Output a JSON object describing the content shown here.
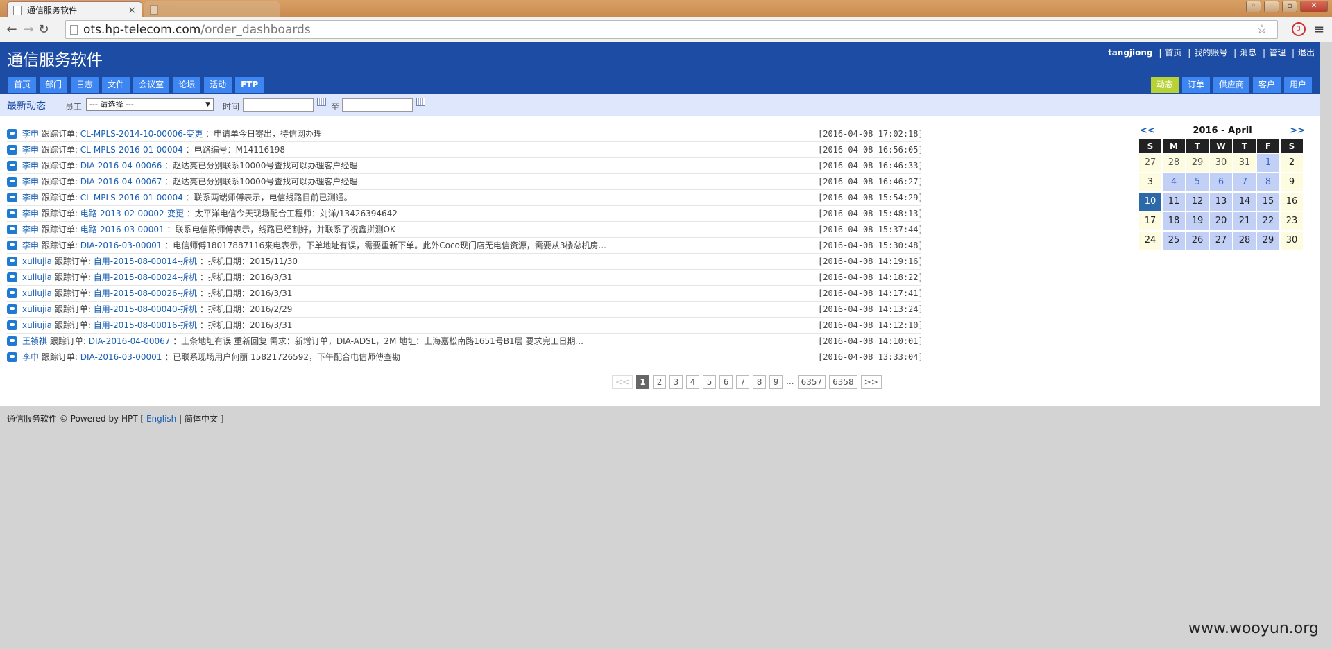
{
  "browser": {
    "active_tab": "通信服务软件",
    "url_host": "ots.hp-telecom.com",
    "url_path": "/order_dashboards",
    "ext_badge": "3"
  },
  "app": {
    "title": "通信服务软件",
    "username": "tangjiong",
    "user_links": [
      "首页",
      "我的账号",
      "消息",
      "管理",
      "退出"
    ],
    "main_nav": [
      "首页",
      "部门",
      "日志",
      "文件",
      "会议室",
      "论坛",
      "活动",
      "FTP"
    ],
    "sub_nav": [
      "动态",
      "订单",
      "供应商",
      "客户",
      "用户"
    ],
    "sub_nav_active": "动态"
  },
  "filter": {
    "title": "最新动态",
    "employee_label": "员工",
    "employee_value": "--- 请选择 ---",
    "time_label": "时间",
    "to_label": "至"
  },
  "feed": [
    {
      "user": "李申",
      "track": "跟踪订单:",
      "order": "CL-MPLS-2014-10-00006-变更",
      "text": "：申请单今日寄出，待信网办理",
      "ts": "[2016-04-08 17:02:18]"
    },
    {
      "user": "李申",
      "track": "跟踪订单:",
      "order": "CL-MPLS-2016-01-00004",
      "text": "：电路编号：M14116198",
      "ts": "[2016-04-08 16:56:05]"
    },
    {
      "user": "李申",
      "track": "跟踪订单:",
      "order": "DIA-2016-04-00066",
      "text": "：赵达亮已分别联系10000号查找可以办理客户经理",
      "ts": "[2016-04-08 16:46:33]"
    },
    {
      "user": "李申",
      "track": "跟踪订单:",
      "order": "DIA-2016-04-00067",
      "text": "：赵达亮已分别联系10000号查找可以办理客户经理",
      "ts": "[2016-04-08 16:46:27]"
    },
    {
      "user": "李申",
      "track": "跟踪订单:",
      "order": "CL-MPLS-2016-01-00004",
      "text": "：联系两端师傅表示，电信线路目前已测通。",
      "ts": "[2016-04-08 15:54:29]"
    },
    {
      "user": "李申",
      "track": "跟踪订单:",
      "order": "电路-2013-02-00002-变更",
      "text": "：太平洋电信今天现场配合工程师：刘洋/13426394642",
      "ts": "[2016-04-08 15:48:13]"
    },
    {
      "user": "李申",
      "track": "跟踪订单:",
      "order": "电路-2016-03-00001",
      "text": "：联系电信陈师傅表示，线路已经割好，并联系了祝鑫拼测OK",
      "ts": "[2016-04-08 15:37:44]"
    },
    {
      "user": "李申",
      "track": "跟踪订单:",
      "order": "DIA-2016-03-00001",
      "text": "：电信师傅18017887116来电表示，下单地址有误，需要重新下单。此外Coco现门店无电信资源，需要从3楼总机房...",
      "ts": "[2016-04-08 15:30:48]"
    },
    {
      "user": "xuliujia",
      "track": "跟踪订单:",
      "order": "自用-2015-08-00014-拆机",
      "text": "：拆机日期：2015/11/30",
      "ts": "[2016-04-08 14:19:16]"
    },
    {
      "user": "xuliujia",
      "track": "跟踪订单:",
      "order": "自用-2015-08-00024-拆机",
      "text": "：拆机日期：2016/3/31",
      "ts": "[2016-04-08 14:18:22]"
    },
    {
      "user": "xuliujia",
      "track": "跟踪订单:",
      "order": "自用-2015-08-00026-拆机",
      "text": "：拆机日期：2016/3/31",
      "ts": "[2016-04-08 14:17:41]"
    },
    {
      "user": "xuliujia",
      "track": "跟踪订单:",
      "order": "自用-2015-08-00040-拆机",
      "text": "：拆机日期：2016/2/29",
      "ts": "[2016-04-08 14:13:24]"
    },
    {
      "user": "xuliujia",
      "track": "跟踪订单:",
      "order": "自用-2015-08-00016-拆机",
      "text": "：拆机日期：2016/3/31",
      "ts": "[2016-04-08 14:12:10]"
    },
    {
      "user": "王祯祺",
      "track": "跟踪订单:",
      "order": "DIA-2016-04-00067",
      "text": "：上条地址有误 重新回复 需求：新增订单，DIA-ADSL，2M 地址：上海嘉松南路1651号B1层 要求完工日期...",
      "ts": "[2016-04-08 14:10:01]"
    },
    {
      "user": "李申",
      "track": "跟踪订单:",
      "order": "DIA-2016-03-00001",
      "text": "：已联系现场用户何丽 15821726592，下午配合电信师傅查勘",
      "ts": "[2016-04-08 13:33:04]"
    }
  ],
  "pager": [
    "<<",
    "1",
    "2",
    "3",
    "4",
    "5",
    "6",
    "7",
    "8",
    "9",
    "...",
    "6357",
    "6358",
    ">>"
  ],
  "pager_current": "1",
  "calendar": {
    "prev": "<<",
    "next": ">>",
    "title": "2016 - April",
    "dow": [
      "S",
      "M",
      "T",
      "W",
      "T",
      "F",
      "S"
    ],
    "weeks": [
      [
        "27",
        "28",
        "29",
        "30",
        "31",
        "1",
        "2"
      ],
      [
        "3",
        "4",
        "5",
        "6",
        "7",
        "8",
        "9"
      ],
      [
        "10",
        "11",
        "12",
        "13",
        "14",
        "15",
        "16"
      ],
      [
        "17",
        "18",
        "19",
        "20",
        "21",
        "22",
        "23"
      ],
      [
        "24",
        "25",
        "26",
        "27",
        "28",
        "29",
        "30"
      ]
    ],
    "today": "10"
  },
  "footer": {
    "app": "通信服务软件",
    "powered": "© Powered by HPT [",
    "lang_en": "English",
    "lang_sep": "|",
    "lang_zh": "简体中文",
    "close": "]"
  },
  "watermark": "www.wooyun.org",
  "colors": {
    "header": "#1c4ca4",
    "nav": "#3d85f0",
    "active_nav": "#b8d233",
    "link": "#1a5fb4"
  }
}
